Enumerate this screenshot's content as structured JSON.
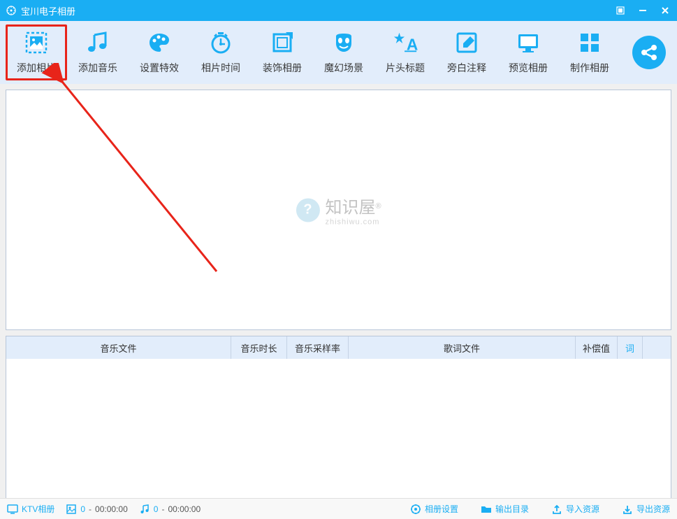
{
  "titlebar": {
    "title": "宝川电子相册"
  },
  "toolbar": {
    "items": [
      {
        "label": "添加相片",
        "icon": "image"
      },
      {
        "label": "添加音乐",
        "icon": "music"
      },
      {
        "label": "设置特效",
        "icon": "palette"
      },
      {
        "label": "相片时间",
        "icon": "clock"
      },
      {
        "label": "装饰相册",
        "icon": "frame"
      },
      {
        "label": "魔幻场景",
        "icon": "mask"
      },
      {
        "label": "片头标题",
        "icon": "star-a"
      },
      {
        "label": "旁白注释",
        "icon": "edit"
      },
      {
        "label": "预览相册",
        "icon": "monitor"
      },
      {
        "label": "制作相册",
        "icon": "grid"
      }
    ]
  },
  "watermark": {
    "badge": "?",
    "text": "知识屋",
    "reg": "®",
    "sub": "zhishiwu.com"
  },
  "music_table": {
    "headers": {
      "file": "音乐文件",
      "duration": "音乐时长",
      "sample_rate": "音乐采样率",
      "lyrics_file": "歌词文件",
      "compensation": "补偿值",
      "lyrics": "词"
    }
  },
  "statusbar": {
    "album_type": "KTV相册",
    "photo_count": "0",
    "photo_duration": "00:00:00",
    "music_count": "0",
    "music_duration": "00:00:00",
    "settings": "相册设置",
    "output_dir": "输出目录",
    "import": "导入资源",
    "export": "导出资源"
  }
}
